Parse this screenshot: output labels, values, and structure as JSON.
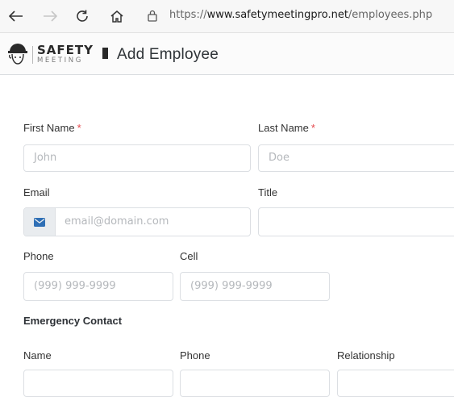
{
  "browser": {
    "url_prefix": "https://",
    "url_host": "www.safetymeetingpro.net",
    "url_path": "/employees.php"
  },
  "header": {
    "logo_top": "SAFETY",
    "logo_bottom": "MEETING",
    "title": "Add Employee"
  },
  "form": {
    "first_name_label": "First Name",
    "first_name_placeholder": "John",
    "last_name_label": "Last Name",
    "last_name_placeholder": "Doe",
    "required_marker": "*",
    "email_label": "Email",
    "email_placeholder": "email@domain.com",
    "title_label": "Title",
    "title_placeholder": "",
    "phone_label": "Phone",
    "phone_placeholder": "(999) 999-9999",
    "cell_label": "Cell",
    "cell_placeholder": "(999) 999-9999",
    "emergency_title": "Emergency Contact",
    "ec_name_label": "Name",
    "ec_phone_label": "Phone",
    "ec_relationship_label": "Relationship"
  },
  "colors": {
    "required": "#e5484d",
    "email_icon": "#2f6fb5"
  }
}
